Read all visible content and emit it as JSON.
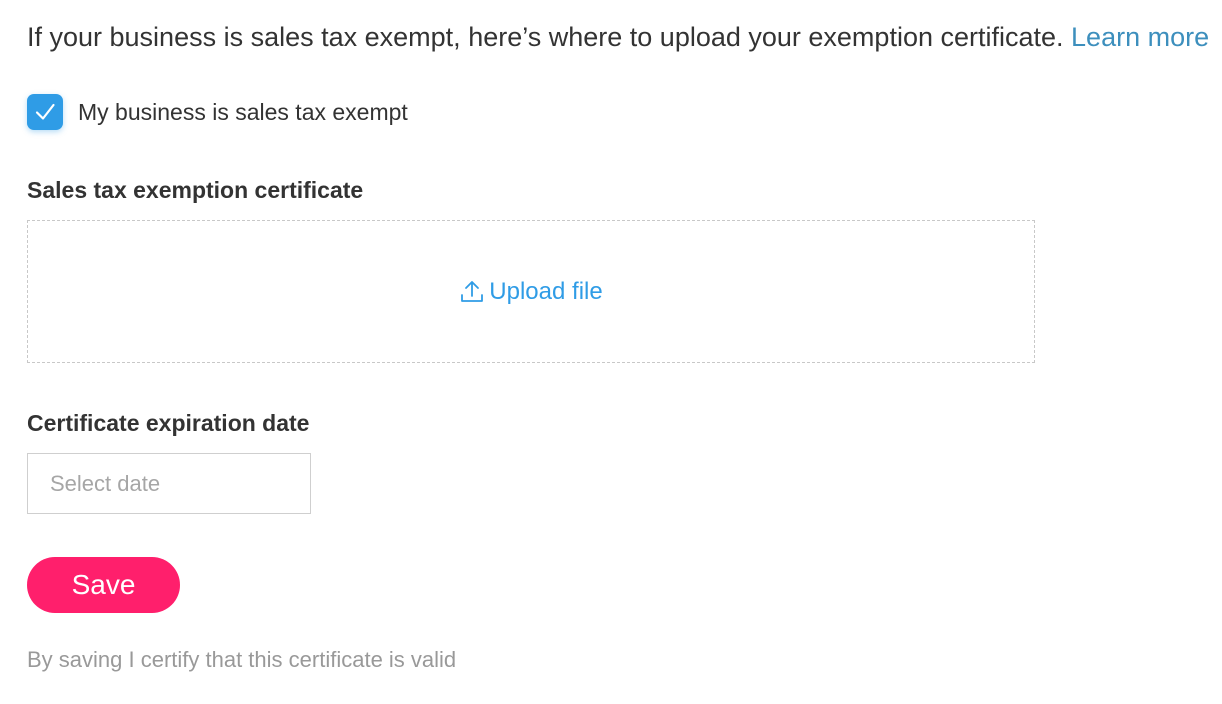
{
  "intro": {
    "text": "If your business is sales tax exempt, here’s where to upload your exemption certificate.",
    "link_label": "Learn more"
  },
  "exempt_checkbox": {
    "label": "My business is sales tax exempt",
    "checked": true,
    "icon": "checkmark-icon"
  },
  "certificate": {
    "label": "Sales tax exemption certificate",
    "upload_label": "Upload file",
    "upload_icon": "upload-icon"
  },
  "expiration": {
    "label": "Certificate expiration date",
    "placeholder": "Select date",
    "value": ""
  },
  "save": {
    "label": "Save"
  },
  "footnote": {
    "text": "By saving I certify that this certificate is valid"
  },
  "colors": {
    "link": "#3d8fbd",
    "accent_blue": "#2f9ce6",
    "save_button": "#ff1f6c",
    "muted_text": "#999999"
  }
}
